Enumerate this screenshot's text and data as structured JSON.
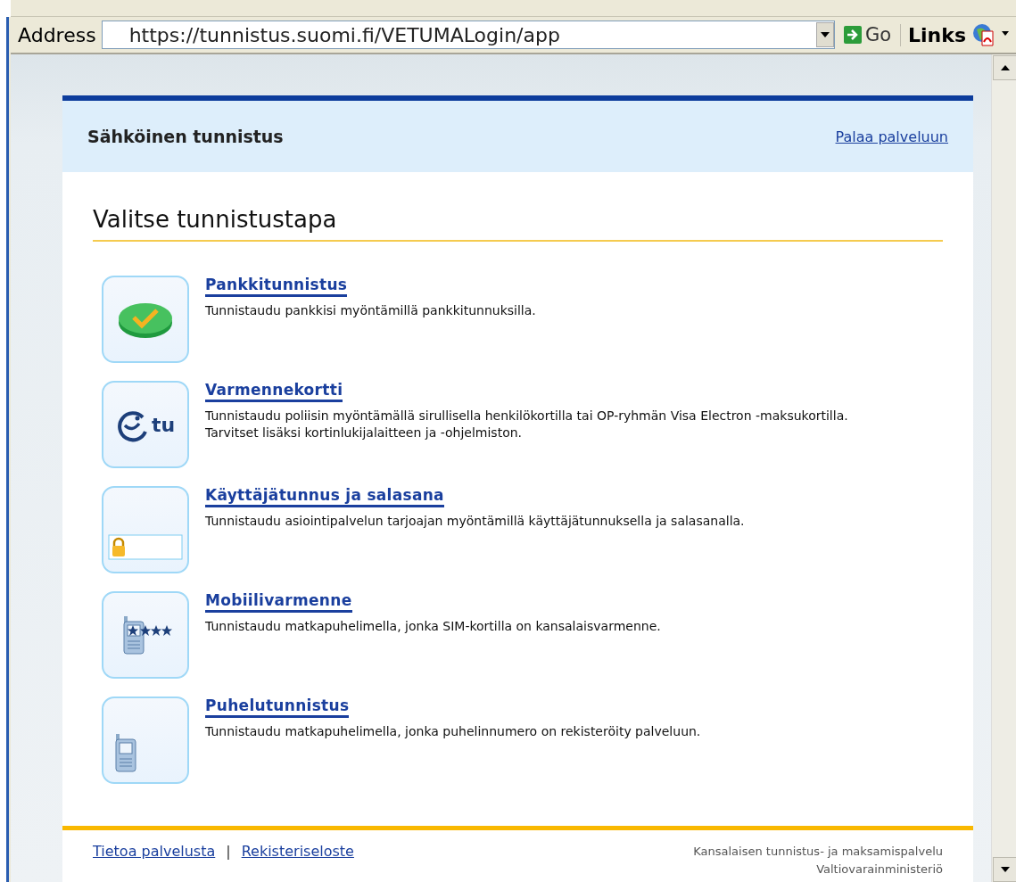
{
  "browser": {
    "address_label": "Address",
    "url": "https://tunnistus.suomi.fi/VETUMALogin/app",
    "go": "Go",
    "links": "Links"
  },
  "header": {
    "title": "Sähköinen tunnistus",
    "back_link": "Palaa palveluun"
  },
  "heading": "Valitse tunnistustapa",
  "methods": [
    {
      "kind": "bank",
      "title": "Pankkitunnistus",
      "description": "Tunnistaudu pankkisi myöntämillä pankkitunnuksilla."
    },
    {
      "kind": "card",
      "icon_text": "tu",
      "title": "Varmennekortti",
      "description": "Tunnistaudu poliisin myöntämällä sirullisella henkilökortilla tai OP-ryhmän Visa Electron -maksukortilla. Tarvitset lisäksi kortinlukijalaitteen ja -ohjelmiston."
    },
    {
      "kind": "password",
      "title": "Käyttäjätunnus ja salasana",
      "description": "Tunnistaudu asiointipalvelun tarjoajan myöntämillä käyttäjätunnuksella ja salasanalla."
    },
    {
      "kind": "mobile",
      "title": "Mobiilivarmenne",
      "description": "Tunnistaudu matkapuhelimella, jonka SIM-kortilla on kansalaisvarmenne."
    },
    {
      "kind": "phone",
      "title": "Puhelutunnistus",
      "description": "Tunnistaudu matkapuhelimella, jonka puhelinnumero on rekisteröity palveluun."
    }
  ],
  "footer": {
    "links": [
      "Tietoa palvelusta",
      "Rekisteriseloste"
    ],
    "separator": "|",
    "lines": [
      "Kansalaisen tunnistus- ja maksamispalvelu",
      "Valtiovarainministeriö"
    ]
  }
}
